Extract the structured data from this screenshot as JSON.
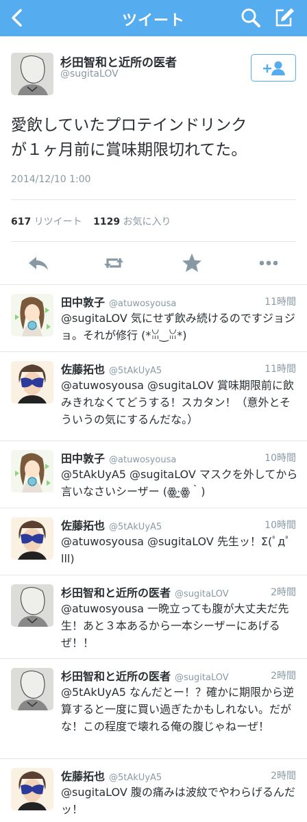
{
  "nav": {
    "title": "ツイート"
  },
  "tweet": {
    "author_name": "杉田智和と近所の医者",
    "author_handle": "@sugitaLOV",
    "text_line1": "愛飲していたプロテインドリンク",
    "text_line2": "が１ヶ月前に賞味期限切れてた。",
    "date": "2014/12/10 1:00",
    "retweet_count": "617",
    "retweet_label": "リツイート",
    "fav_count": "1129",
    "fav_label": "お気に入り"
  },
  "replies": [
    {
      "name": "田中敦子",
      "handle": "@atuwosyousa",
      "time": "11時間",
      "text": "@sugitaLOV 気にせず飲み続けるのですジョジョ。それが修行 (*ꈍ‿ꈍ*)"
    },
    {
      "name": "佐藤拓也",
      "handle": "@5tAkUyA5",
      "time": "11時間",
      "text": "@atuwosyousa @sugitaLOV 賞味期限前に飲みきれなくてどうする！スカタン！（意外とそういうの気にするんだな。）"
    },
    {
      "name": "田中敦子",
      "handle": "@atuwosyousa",
      "time": "10時間",
      "text": "@5tAkUyA5 @sugitaLOV マスクを外してから言いなさいシーザー (ꙮ·̫ꙮ｀)"
    },
    {
      "name": "佐藤拓也",
      "handle": "@5tAkUyA5",
      "time": "10時間",
      "text": "@atuwosyousa @sugitaLOV 先生ッ！Σ(ﾟдﾟlll)"
    },
    {
      "name": "杉田智和と近所の医者",
      "handle": "@sugitaLOV",
      "time": "2時間",
      "text": "@atuwosyousa 一晩立っても腹が大丈夫だ先生！あと３本あるから一本シーザーにあげるぜ！！"
    },
    {
      "name": "杉田智和と近所の医者",
      "handle": "@sugitaLOV",
      "time": "2時間",
      "text": "@5tAkUyA5 なんだとー！？確かに期限から逆算すると一度に買い過ぎたかもしれない。だがな！この程度で壊れる俺の腹じゃねーぜ！"
    },
    {
      "name": "佐藤拓也",
      "handle": "@5tAkUyA5",
      "time": "2時間",
      "text": "@sugitaLOV 腹の痛みは波紋でやわらげるんだッ！"
    }
  ],
  "colors": {
    "accent": "#55acee",
    "text": "#292f33",
    "muted": "#8899a6",
    "divider": "#e1e8ed"
  }
}
